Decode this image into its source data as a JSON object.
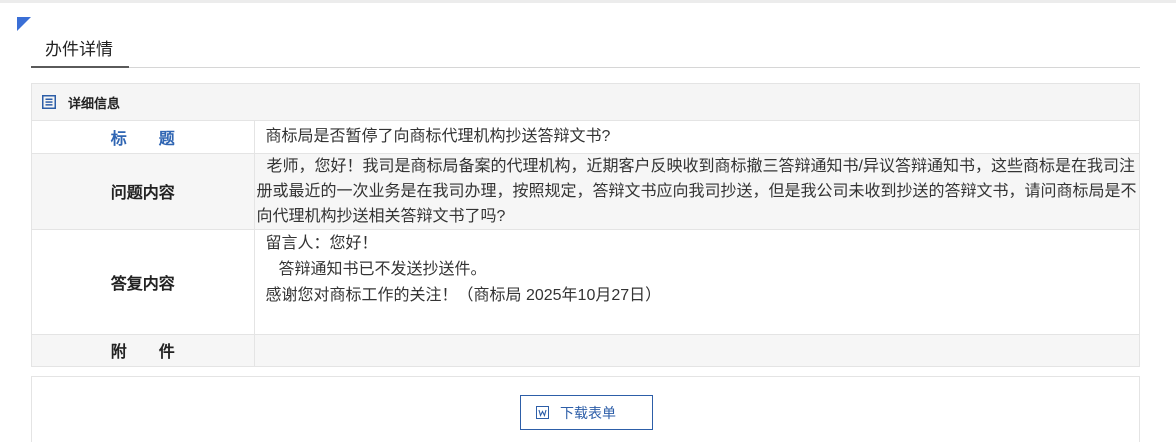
{
  "page": {
    "tab_title": "办件详情"
  },
  "panel": {
    "title": "详细信息",
    "icon": "list-icon"
  },
  "details": {
    "title": {
      "label": "标　　题",
      "value": "商标局是否暂停了向商标代理机构抄送答辩文书?"
    },
    "question": {
      "label": "问题内容",
      "value": "老师，您好！我司是商标局备案的代理机构，近期客户反映收到商标撤三答辩通知书/异议答辩通知书，这些商标是在我司注册或最近的一次业务是在我司办理，按照规定，答辩文书应向我司抄送，但是我公司未收到抄送的答辩文书，请问商标局是不向代理机构抄送相关答辩文书了吗?"
    },
    "reply": {
      "label": "答复内容",
      "lines": [
        "留言人：您好！",
        "答辩通知书已不发送抄送件。",
        "感谢您对商标工作的关注！（商标局 2025年10月27日）"
      ]
    },
    "attachment": {
      "label": "附　　件",
      "value": ""
    }
  },
  "download": {
    "label": "下载表单",
    "icon": "word-document-icon"
  },
  "colors": {
    "accent_blue": "#2f65b3",
    "corner_blue": "#3a6fd6",
    "button_blue": "#2d5ea8",
    "row_gray": "#f6f6f6",
    "border": "#e4e4e4"
  }
}
